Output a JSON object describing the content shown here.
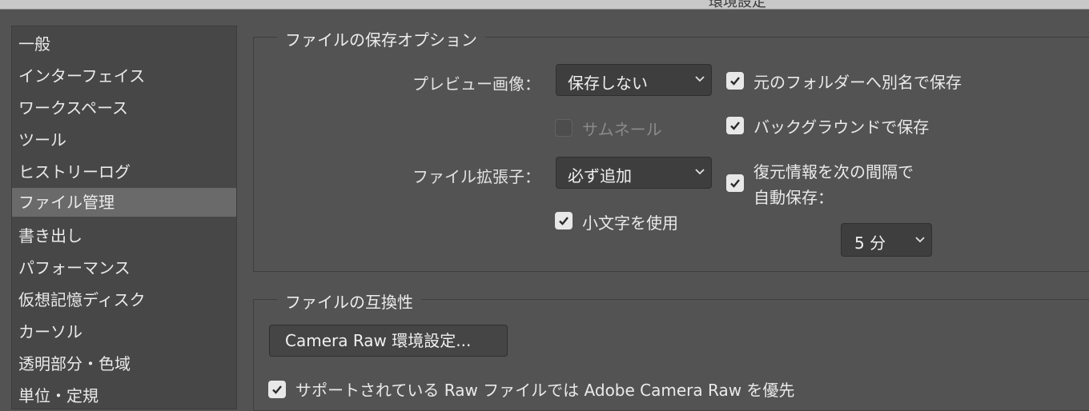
{
  "window": {
    "title": "環境設定"
  },
  "sidebar": {
    "items": [
      {
        "label": "一般"
      },
      {
        "label": "インターフェイス"
      },
      {
        "label": "ワークスペース"
      },
      {
        "label": "ツール"
      },
      {
        "label": "ヒストリーログ"
      },
      {
        "label": "ファイル管理",
        "selected": true
      },
      {
        "label": "書き出し"
      },
      {
        "label": "パフォーマンス"
      },
      {
        "label": "仮想記憶ディスク"
      },
      {
        "label": "カーソル"
      },
      {
        "label": "透明部分・色域"
      },
      {
        "label": "単位・定規"
      }
    ]
  },
  "save_options": {
    "title": "ファイルの保存オプション",
    "preview_label": "プレビュー画像：",
    "preview_value": "保存しない",
    "thumbnail": {
      "label": "サムネール",
      "checked": false,
      "disabled": true
    },
    "extension_label": "ファイル拡張子：",
    "extension_value": "必ず追加",
    "lowercase": {
      "label": "小文字を使用",
      "checked": true
    },
    "save_as_original": {
      "label": "元のフォルダーへ別名で保存",
      "checked": true
    },
    "background_save": {
      "label": "バックグラウンドで保存",
      "checked": true
    },
    "autosave": {
      "label_line1": "復元情報を次の間隔で",
      "label_line2": "自動保存：",
      "checked": true
    },
    "autosave_interval": "5 分"
  },
  "compatibility": {
    "title": "ファイルの互換性",
    "camera_raw_button": "Camera Raw 環境設定...",
    "prefer_acr": {
      "label": "サポートされている Raw ファイルでは Adobe Camera Raw を優先",
      "checked": true
    }
  },
  "colors": {
    "background": "#535353",
    "sidebar": "#474747",
    "selected": "#6a6a6a",
    "checkbox": "#e8e8e8"
  },
  "icons": {
    "checkmark": "checkmark-icon",
    "dropdown": "chevron-down-icon"
  }
}
